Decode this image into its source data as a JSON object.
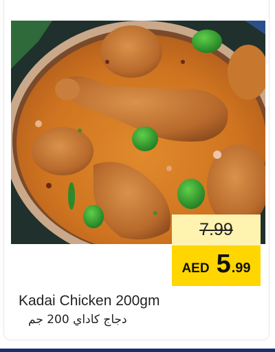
{
  "product": {
    "name_en": "Kadai Chicken 200gm",
    "name_ar": "دجاج كاداي 200 جم",
    "image_subject": "kadai-chicken-curry-bowl"
  },
  "price": {
    "old": "7.99",
    "currency": "AED",
    "new_integer": "5",
    "new_decimal": ".99"
  },
  "colors": {
    "badge_new_bg": "#ffd600",
    "badge_old_bg": "#fff3b0",
    "accent_strip": "#1b2f6e"
  }
}
